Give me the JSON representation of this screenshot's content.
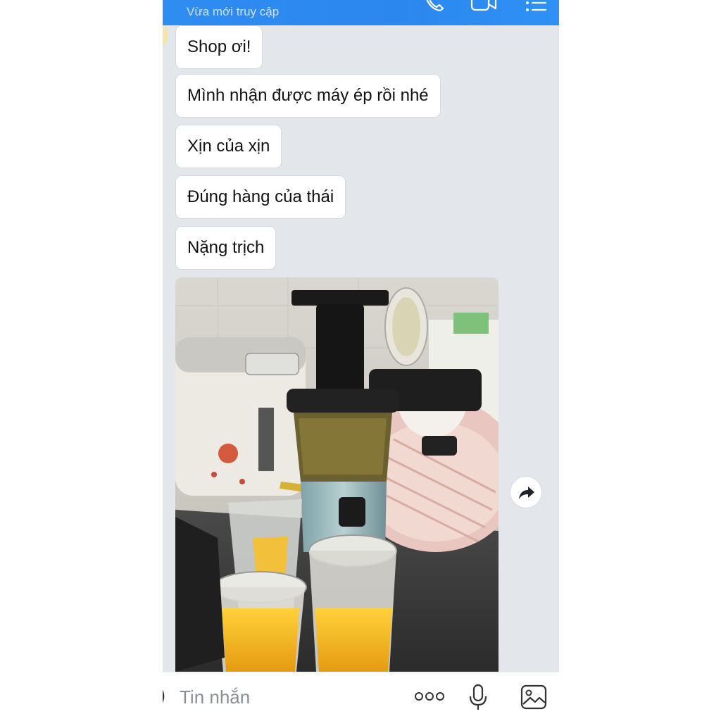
{
  "header": {
    "status_text": "Vừa mới truy cập",
    "icons": [
      "phone-icon",
      "video-call-icon",
      "menu-list-icon"
    ]
  },
  "messages": [
    {
      "text": "Shop ơi!"
    },
    {
      "text": "Mình nhận được máy ép rồi nhé"
    },
    {
      "text": "Xịn của xịn"
    },
    {
      "text": "Đúng hàng của thái"
    },
    {
      "text": "Nặng trịch"
    }
  ],
  "photo_message": {
    "subject": "slow juicer with two glasses of orange juice on kitchen counter",
    "action_icon": "forward-share-icon"
  },
  "input_bar": {
    "placeholder": "Tin nhắn",
    "icons": [
      "emoji-icon",
      "more-dots-icon",
      "microphone-icon",
      "image-gallery-icon"
    ]
  },
  "colors": {
    "header_bg": "#2f8cf0",
    "chat_bg": "#e3e7ec",
    "bubble_bg": "#ffffff",
    "juice": "#f4b81f"
  }
}
